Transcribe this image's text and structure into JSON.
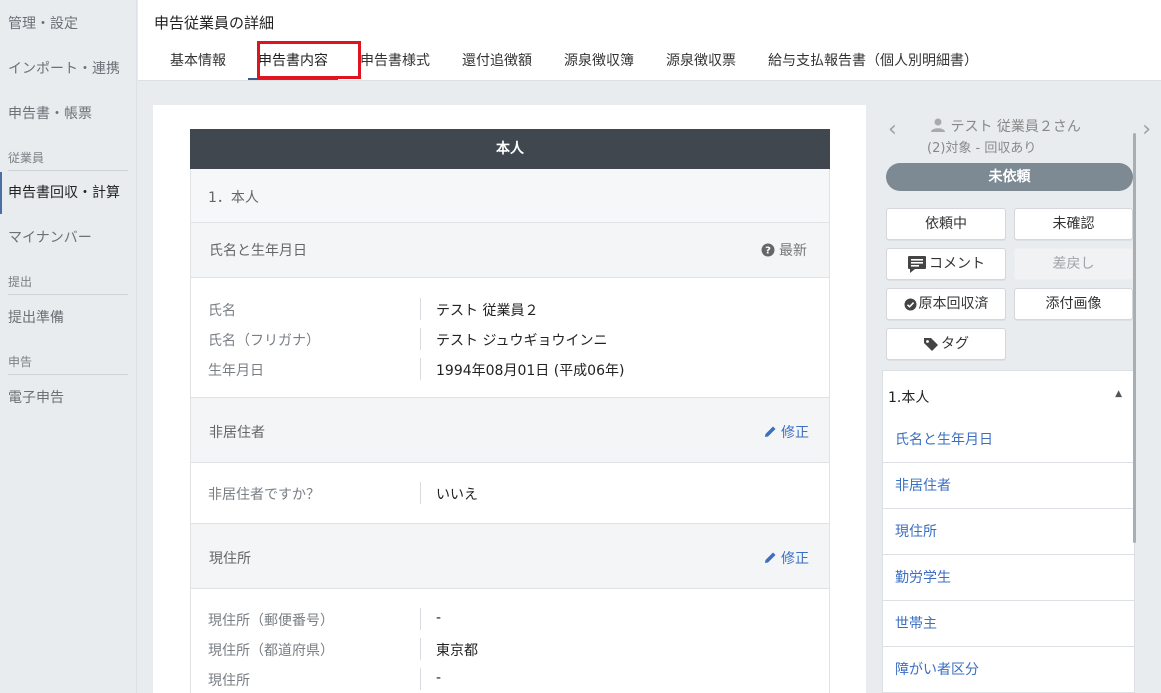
{
  "sidebar": {
    "items": [
      {
        "label": "管理・設定"
      },
      {
        "label": "インポート・連携"
      },
      {
        "label": "申告書・帳票"
      },
      {
        "label": "申告書回収・計算"
      },
      {
        "label": "マイナンバー"
      },
      {
        "label": "提出準備"
      },
      {
        "label": "電子申告"
      }
    ],
    "sections": {
      "employee": "従業員",
      "submission": "提出",
      "filing": "申告"
    }
  },
  "header": {
    "title": "申告従業員の詳細",
    "tabs": [
      {
        "label": "基本情報"
      },
      {
        "label": "申告書内容"
      },
      {
        "label": "申告書様式"
      },
      {
        "label": "還付追徴額"
      },
      {
        "label": "源泉徴収簿"
      },
      {
        "label": "源泉徴収票"
      },
      {
        "label": "給与支払報告書（個人別明細書）"
      }
    ],
    "active_tab": "申告書内容"
  },
  "main": {
    "section_title": "本人",
    "block_title": "1．本人",
    "groups": {
      "name": {
        "title": "氏名と生年月日",
        "info_label": "最新",
        "rows": [
          {
            "label": "氏名",
            "value": "テスト 従業員２"
          },
          {
            "label": "氏名（フリガナ）",
            "value": "テスト ジュウギョウインニ"
          },
          {
            "label": "生年月日",
            "value": "1994年08月01日 (平成06年)"
          }
        ]
      },
      "nonresident": {
        "title": "非居住者",
        "action_label": "修正",
        "rows": [
          {
            "label": "非居住者ですか？",
            "value": "いいえ"
          }
        ]
      },
      "address": {
        "title": "現住所",
        "action_label": "修正",
        "rows": [
          {
            "label": "現住所（郵便番号）",
            "value": "-"
          },
          {
            "label": "現住所（都道府県）",
            "value": "東京都"
          },
          {
            "label": "現住所",
            "value": "-"
          }
        ]
      }
    }
  },
  "right_panel": {
    "employee_name": "テスト 従業員２さん",
    "employee_status": "(2)対象 - 回収あり",
    "status_pill": "未依頼",
    "buttons": {
      "requesting": "依頼中",
      "unconfirmed": "未確認",
      "comment": "コメント",
      "send_back": "差戻し",
      "original_received": "原本回収済",
      "attached_image": "添付画像",
      "tag": "タグ"
    },
    "select_label": "1.本人",
    "list_items": [
      {
        "label": "氏名と生年月日"
      },
      {
        "label": "非居住者"
      },
      {
        "label": "現住所"
      },
      {
        "label": "勤労学生"
      },
      {
        "label": "世帯主"
      },
      {
        "label": "障がい者区分"
      }
    ]
  },
  "colors": {
    "accent": "#3b6fc2",
    "section_header_bg": "#41474f",
    "status_pill_bg": "#7d8a94",
    "highlight_box": "#e0141e"
  }
}
